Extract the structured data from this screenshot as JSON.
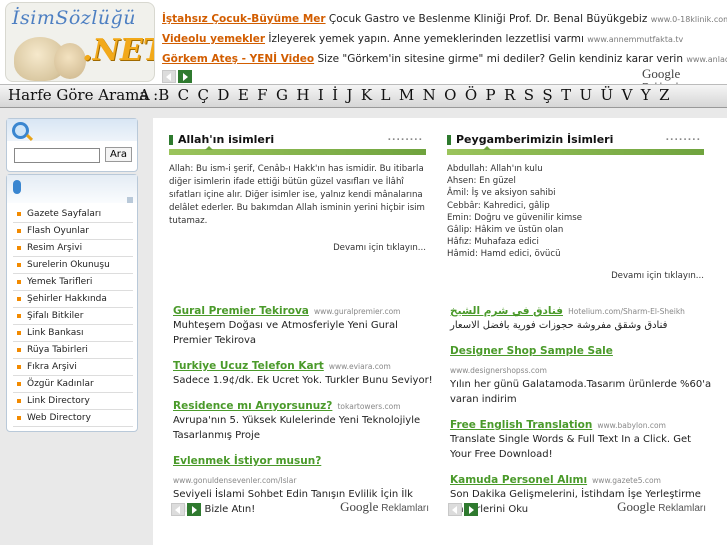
{
  "logo": {
    "line1": "İsimSözlüğü",
    "line2": ".NET"
  },
  "top_ads": [
    {
      "title": "İştahsız Çocuk-Büyüme Mer",
      "text": "Çocuk Gastro ve Beslenme Kliniği Prof. Dr. Benal Büyükgebiz",
      "url": "www.0-18klinik.com"
    },
    {
      "title": "Videolu yemekler",
      "text": "İzleyerek yemek yapın. Anne yemeklerinden lezzetlisi varmı",
      "url": "www.annemmutfakta.tv"
    },
    {
      "title": "Görkem Ateş - YENİ Video",
      "text": "Size \"Görkem'in sitesine girme\" mi dediler? Gelin kendiniz karar verin",
      "url": "www.anladuy.net"
    }
  ],
  "google_ads": {
    "brand": "Google",
    "suffix": "Reklamları"
  },
  "alphabet": {
    "label": "Harfe Göre Arama :",
    "letters": [
      "A",
      "B",
      "C",
      "Ç",
      "D",
      "E",
      "F",
      "G",
      "H",
      "I",
      "İ",
      "J",
      "K",
      "L",
      "M",
      "N",
      "O",
      "Ö",
      "P",
      "R",
      "S",
      "Ş",
      "T",
      "U",
      "Ü",
      "V",
      "Y",
      "Z"
    ]
  },
  "search": {
    "button": "Ara",
    "value": ""
  },
  "menu": [
    "Gazete Sayfaları",
    "Flash Oyunlar",
    "Resim Arşivi",
    "Surelerin Okunuşu",
    "Yemek Tarifleri",
    "Şehirler Hakkında",
    "Şifalı Bitkiler",
    "Link Bankası",
    "Rüya Tabirleri",
    "Fıkra Arşivi",
    "Özgür Kadınlar",
    "Link Directory",
    "Web Directory"
  ],
  "allah_section": {
    "title": "Allah'ın isimleri",
    "dots": "........",
    "body": "Allah: Bu ism-i şerif, Cenâb-ı Hakk'ın has ismidir. Bu itibarla diğer isimlerin ifade ettiği bütün güzel vasıfları ve İlâhî sıfatları içine alır. Diğer isimler ise, yalnız kendi mânalarına delâlet ederler. Bu bakımdan Allah isminin yerini hiçbir isim tutamaz.",
    "more": "Devamı için tıklayın..."
  },
  "prophet_section": {
    "title": "Peygamberimizin İsimleri",
    "dots": "........",
    "items": [
      "Abdullah: Allah'ın kulu",
      "Ahsen: En güzel",
      "Âmil: İş ve aksiyon sahibi",
      "Cebbâr: Kahredici, gâlip",
      "Emin: Doğru ve güvenilir kimse",
      "Gâlip: Hâkim ve üstün olan",
      "Hâfız: Muhafaza edici",
      "Hâmid: Hamd edici, övücü"
    ],
    "more": "Devamı için tıklayın..."
  },
  "left_ads": [
    {
      "title": "Gural Premier Tekirova",
      "url": "www.guralpremier.com",
      "text": "Muhteşem Doğası ve Atmosferiyle Yeni Gural Premier Tekirova"
    },
    {
      "title": "Turkiye Ucuz Telefon Kart",
      "url": "www.eviara.com",
      "text": "Sadece 1.9¢/dk. Ek Ucret Yok. Turkler Bunu Seviyor!"
    },
    {
      "title": "Residence mı Arıyorsunuz?",
      "url": "tokartowers.com",
      "text": "Avrupa'nın 5. Yüksek Kulelerinde Yeni Teknolojiyle Tasarlanmış Proje"
    },
    {
      "title": "Evlenmek İstiyor musun?",
      "url": "www.gonuldensevenler.com/Islar",
      "text": "Seviyeli İslami Sohbet Edin Tanışın Evlilik İçin İlk Adımı Bizle Atın!"
    }
  ],
  "right_ads": [
    {
      "title": "فنادق في شرم الشيخ",
      "url": "Hotelium.com/Sharm-El-Sheikh",
      "text": "فنادق وشقق مفروشة حجوزات فورية بافضل الاسعار",
      "rtl": true
    },
    {
      "title": "Designer Shop Sample Sale",
      "url": "www.designershopss.com",
      "text": "Yılın her günü Galatamoda.Tasarım ürünlerde %60'a varan indirim"
    },
    {
      "title": "Free English Translation",
      "url": "www.babylon.com",
      "text": "Translate Single Words & Full Text In a Click. Get Your Free Download!"
    },
    {
      "title": "Kamuda Personel Alımı",
      "url": "www.gazete5.com",
      "text": "Son Dakika Gelişmelerini, İstihdam İşe Yerleştirme Haberlerini Oku"
    }
  ],
  "colors": {
    "ad_title_orange": "#d25d00",
    "ad_title_green": "#4a9a2a",
    "accent_green": "#6fa33e",
    "accent_blue": "#3a86d0"
  }
}
